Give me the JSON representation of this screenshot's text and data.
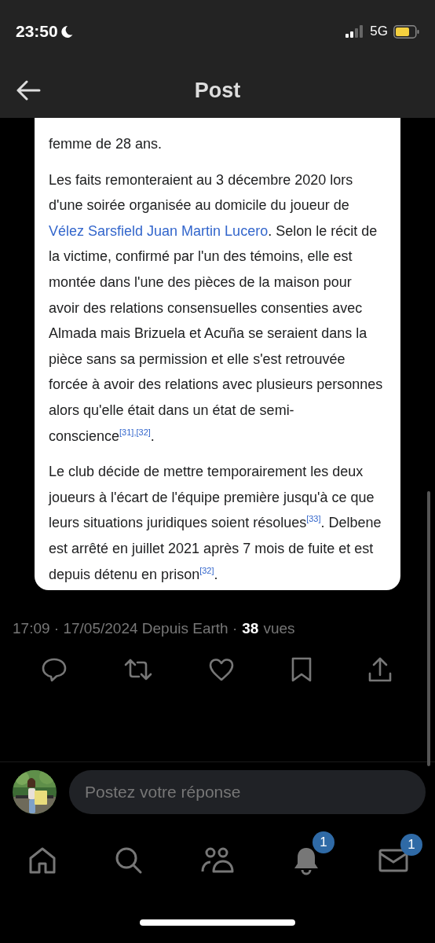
{
  "status_bar": {
    "time": "23:50",
    "network": "5G"
  },
  "header": {
    "title": "Post"
  },
  "article": {
    "paragraphs": [
      [
        {
          "kind": "text",
          "text": "femme de 28 ans."
        }
      ],
      [
        {
          "kind": "text",
          "text": "Les faits remonteraient au 3 décembre 2020 lors d'une soirée organisée au domicile du joueur de "
        },
        {
          "kind": "link",
          "text": "Vélez Sarsfield Juan Martin Lucero"
        },
        {
          "kind": "text",
          "text": ". Selon le récit de la victime, confirmé par l'un des témoins, elle est montée dans l'une des pièces de la maison pour avoir des relations consensuelles consenties avec Almada mais Brizuela et Acuña se seraient dans la pièce sans sa permission et elle s'est retrouvée forcée à avoir des relations avec plusieurs personnes alors qu'elle était dans un état de semi-conscience"
        },
        {
          "kind": "ref",
          "text": "[31]"
        },
        {
          "kind": "ref",
          "text": ",[32]"
        },
        {
          "kind": "text",
          "text": "."
        }
      ],
      [
        {
          "kind": "text",
          "text": "Le club décide de mettre temporairement les deux joueurs à l'écart de l'équipe première jusqu'à ce que leurs situations juridiques soient résolues"
        },
        {
          "kind": "ref",
          "text": "[33]"
        },
        {
          "kind": "text",
          "text": ". Delbene est arrêté en juillet 2021 après 7 mois de fuite et est depuis détenu en prison"
        },
        {
          "kind": "ref",
          "text": "[32]"
        },
        {
          "kind": "text",
          "text": "."
        }
      ]
    ]
  },
  "meta": {
    "posted": "17:09 · 17/05/2024 Depuis Earth ·",
    "views_count": "38",
    "views_label": "vues"
  },
  "reply": {
    "placeholder": "Postez votre réponse"
  },
  "nav": [
    {
      "kind": "home"
    },
    {
      "kind": "search"
    },
    {
      "kind": "communities"
    },
    {
      "kind": "notifications",
      "badge": "1"
    },
    {
      "kind": "messages",
      "badge": "1"
    }
  ]
}
